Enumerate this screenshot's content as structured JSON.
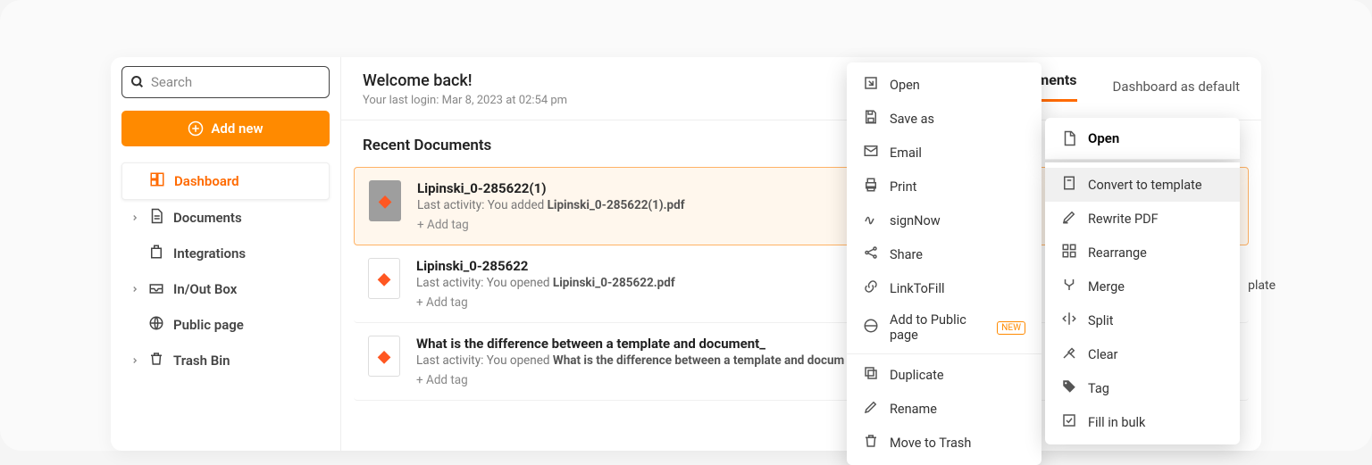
{
  "sidebar": {
    "search_placeholder": "Search",
    "add_new_label": "Add new",
    "nav": [
      {
        "label": "Dashboard",
        "expandable": false,
        "active": true
      },
      {
        "label": "Documents",
        "expandable": true
      },
      {
        "label": "Integrations",
        "expandable": false
      },
      {
        "label": "In/Out Box",
        "expandable": true
      },
      {
        "label": "Public page",
        "expandable": false
      },
      {
        "label": "Trash Bin",
        "expandable": true
      }
    ]
  },
  "header": {
    "welcome": "Welcome back!",
    "last_login": "Your last login: Mar 8, 2023 at 02:54 pm",
    "tab_label": "Documents",
    "dashboard_default": "Dashboard as default"
  },
  "recent": {
    "title": "Recent Documents",
    "add_tag_label": "+ Add tag",
    "items": [
      {
        "title": "Lipinski_0-285622(1)",
        "activity_prefix": "Last activity: You added ",
        "activity_file": "Lipinski_0-285622(1).pdf",
        "selected": true,
        "thumb_dark": true
      },
      {
        "title": "Lipinski_0-285622",
        "activity_prefix": "Last activity: You opened ",
        "activity_file": "Lipinski_0-285622.pdf"
      },
      {
        "title": "What is the difference between a template and document_",
        "activity_prefix": "Last activity: You opened ",
        "activity_file": "What is the difference between a template and docum"
      }
    ]
  },
  "context_menu": {
    "groups": [
      [
        "Open",
        "Save as",
        "Email",
        "Print",
        "signNow",
        "Share",
        "LinkToFill",
        "Add to Public page"
      ],
      [
        "Duplicate",
        "Rename",
        "Move to Trash"
      ]
    ],
    "new_badge_on": "Add to Public page"
  },
  "submenu": {
    "header": "Open",
    "items": [
      "Convert to template",
      "Rewrite PDF",
      "Rearrange",
      "Merge",
      "Split",
      "Clear",
      "Tag",
      "Fill in bulk"
    ],
    "highlight": "Convert to template",
    "trailing_text": "plate"
  }
}
